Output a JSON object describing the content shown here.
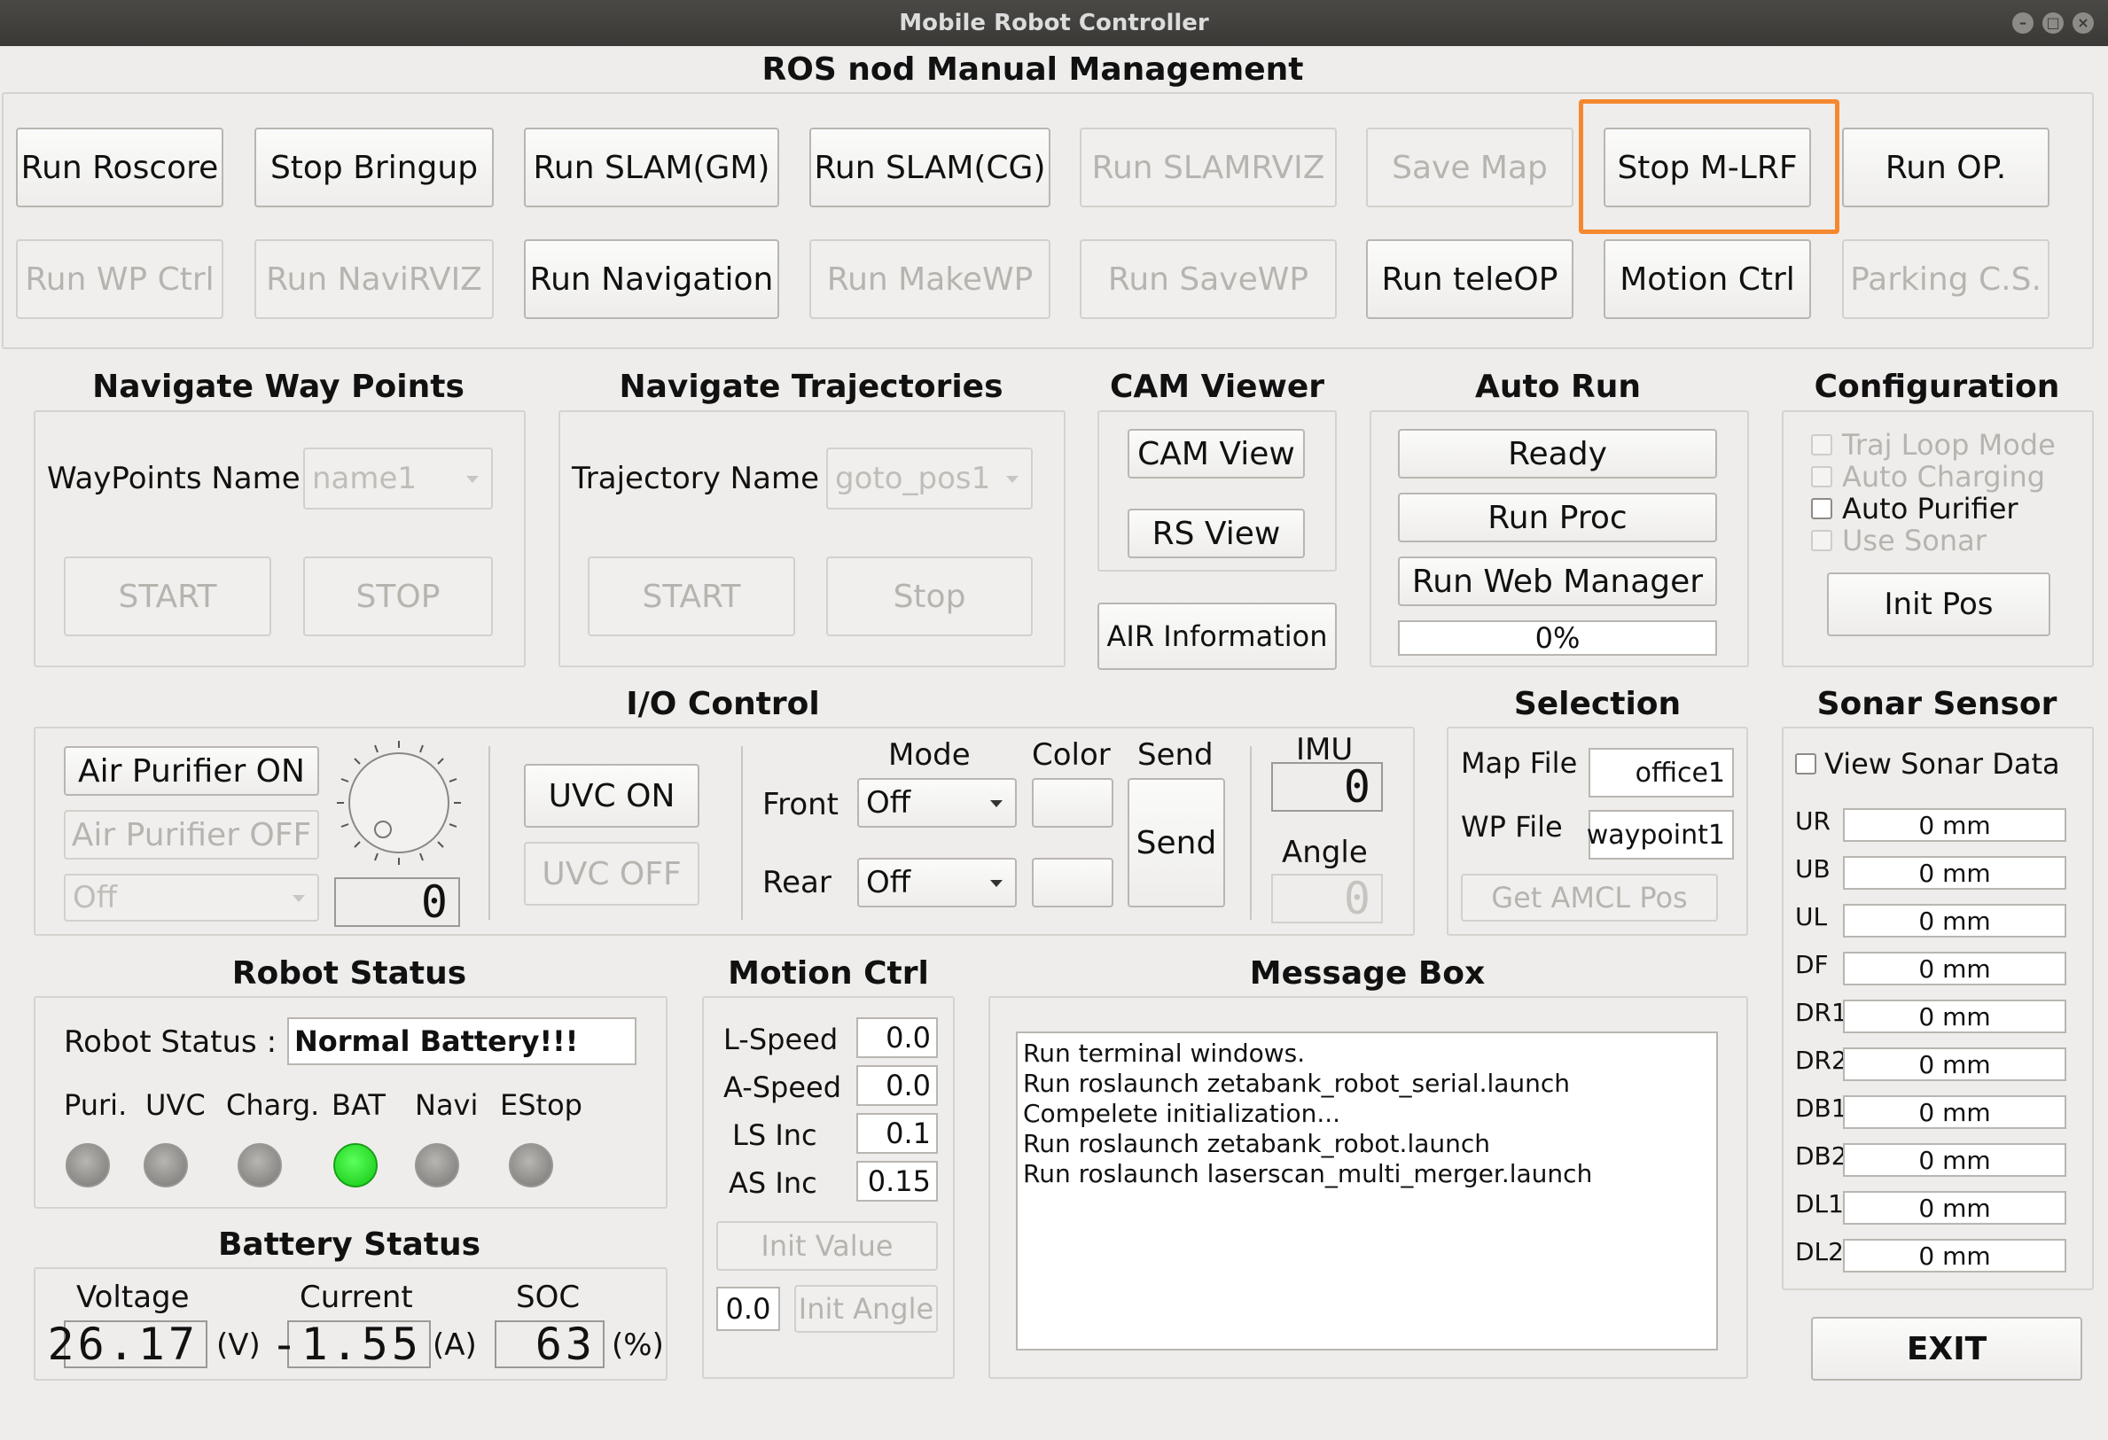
{
  "window": {
    "title": "Mobile Robot Controller"
  },
  "ros": {
    "title": "ROS nod Manual Management",
    "row1": [
      "Run Roscore",
      "Stop Bringup",
      "Run SLAM(GM)",
      "Run SLAM(CG)",
      "Run SLAMRVIZ",
      "Save Map",
      "Stop M-LRF",
      "Run OP."
    ],
    "row2": [
      "Run WP Ctrl",
      "Run NaviRVIZ",
      "Run Navigation",
      "Run MakeWP",
      "Run SaveWP",
      "Run teleOP",
      "Motion Ctrl",
      "Parking C.S."
    ]
  },
  "waypoints": {
    "title": "Navigate Way Points",
    "label": "WayPoints Name :",
    "value": "name1",
    "start": "START",
    "stop": "STOP"
  },
  "trajectories": {
    "title": "Navigate Trajectories",
    "label": "Trajectory Name :",
    "value": "goto_pos1",
    "start": "START",
    "stop": "Stop"
  },
  "cam": {
    "title": "CAM Viewer",
    "cam_view": "CAM View",
    "rs_view": "RS View",
    "air_info": "AIR Information"
  },
  "autorun": {
    "title": "Auto Run",
    "ready": "Ready",
    "run_proc": "Run Proc",
    "web_manager": "Run Web Manager",
    "progress": "0%",
    "progress_value": 0
  },
  "config": {
    "title": "Configuration",
    "traj_loop": "Traj Loop Mode",
    "auto_charging": "Auto Charging",
    "auto_purifier": "Auto Purifier",
    "use_sonar": "Use Sonar",
    "init_pos": "Init Pos"
  },
  "io": {
    "title": "I/O Control",
    "air_on": "Air Purifier ON",
    "air_off": "Air Purifier OFF",
    "air_combo": "Off",
    "dial_lcd": "0",
    "uvc_on": "UVC ON",
    "uvc_off": "UVC OFF",
    "mode": "Mode",
    "color": "Color",
    "send_hdr": "Send",
    "front": "Front",
    "rear": "Rear",
    "front_mode": "Off",
    "rear_mode": "Off",
    "send": "Send",
    "imu": "IMU",
    "imu_lcd": "0",
    "angle": "Angle",
    "angle_lcd": "0"
  },
  "selection": {
    "title": "Selection",
    "map_label": "Map File",
    "map_value": "office1",
    "wp_label": "WP File",
    "wp_value": "waypoint1",
    "amcl": "Get AMCL Pos"
  },
  "sonar": {
    "title": "Sonar Sensor",
    "view": "View Sonar Data",
    "rows": [
      {
        "name": "UR",
        "value": "0 mm"
      },
      {
        "name": "UB",
        "value": "0 mm"
      },
      {
        "name": "UL",
        "value": "0 mm"
      },
      {
        "name": "DF",
        "value": "0 mm"
      },
      {
        "name": "DR1",
        "value": "0 mm"
      },
      {
        "name": "DR2",
        "value": "0 mm"
      },
      {
        "name": "DB1",
        "value": "0 mm"
      },
      {
        "name": "DB2",
        "value": "0 mm"
      },
      {
        "name": "DL1",
        "value": "0 mm"
      },
      {
        "name": "DL2",
        "value": "0 mm"
      }
    ]
  },
  "robot": {
    "title": "Robot Status",
    "label": "Robot Status :",
    "value": "Normal Battery!!!",
    "leds": [
      {
        "label": "Puri.",
        "on": false
      },
      {
        "label": "UVC",
        "on": false
      },
      {
        "label": "Charg.",
        "on": false
      },
      {
        "label": "BAT",
        "on": true
      },
      {
        "label": "Navi",
        "on": false
      },
      {
        "label": "EStop",
        "on": false
      }
    ]
  },
  "battery": {
    "title": "Battery Status",
    "voltage": "Voltage",
    "current": "Current",
    "soc": "SOC",
    "v": "26.17",
    "a": "-1.55",
    "pct": "63",
    "v_unit": "(V)",
    "a_unit": "(A)",
    "pct_unit": "(%)"
  },
  "motion": {
    "title": "Motion Ctrl",
    "lspeed": "L-Speed",
    "aspeed": "A-Speed",
    "lsinc": "LS Inc",
    "asinc": "AS Inc",
    "lspeed_v": "0.0",
    "aspeed_v": "0.0",
    "lsinc_v": "0.1",
    "asinc_v": "0.15",
    "init_value": "Init Value",
    "angle_v": "0.0",
    "init_angle": "Init Angle"
  },
  "message": {
    "title": "Message Box",
    "lines": [
      "Run terminal windows.",
      "Run roslaunch zetabank_robot_serial.launch",
      "Compelete initialization...",
      "Run roslaunch zetabank_robot.launch",
      "Run roslaunch laserscan_multi_merger.launch"
    ]
  },
  "exit": "EXIT"
}
